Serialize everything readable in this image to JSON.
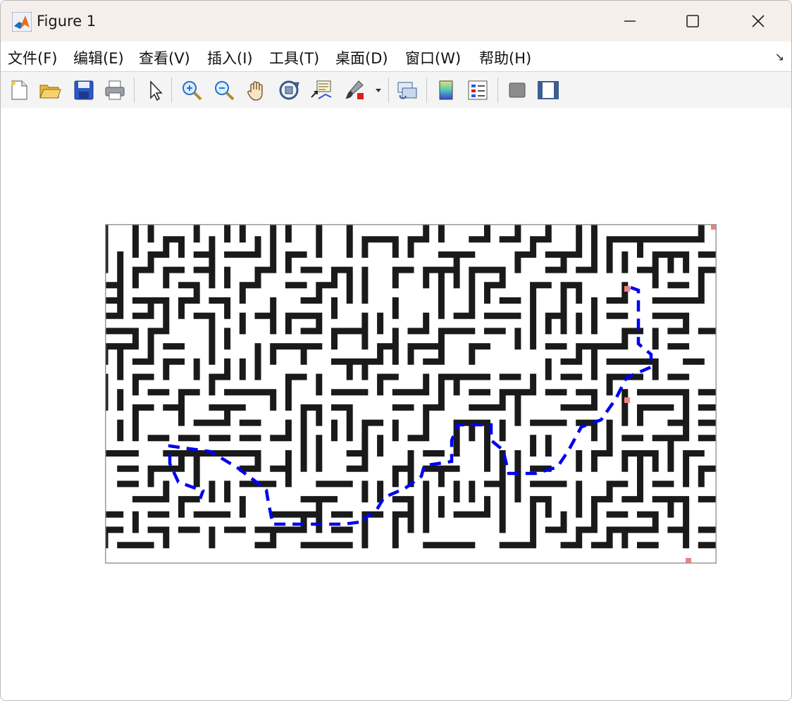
{
  "window": {
    "title": "Figure 1"
  },
  "menu": {
    "file": "文件(F)",
    "edit": "编辑(E)",
    "view": "查看(V)",
    "insert": "插入(I)",
    "tools": "工具(T)",
    "desktop": "桌面(D)",
    "window": "窗口(W)",
    "help": "帮助(H)"
  },
  "toolbar": {
    "icons": [
      "new-figure-icon",
      "open-file-icon",
      "save-icon",
      "print-icon",
      "edit-plot-arrow-icon",
      "zoom-in-icon",
      "zoom-out-icon",
      "pan-hand-icon",
      "rotate-3d-icon",
      "data-cursor-icon",
      "brush-icon",
      "link-plot-icon",
      "colorbar-icon",
      "legend-icon",
      "hide-plot-tools-icon",
      "show-plot-tools-icon"
    ]
  },
  "colors": {
    "wall": "#1a1a1a",
    "path": "#0000ee",
    "marker": "#f08080",
    "border": "#9a9a9a"
  }
}
